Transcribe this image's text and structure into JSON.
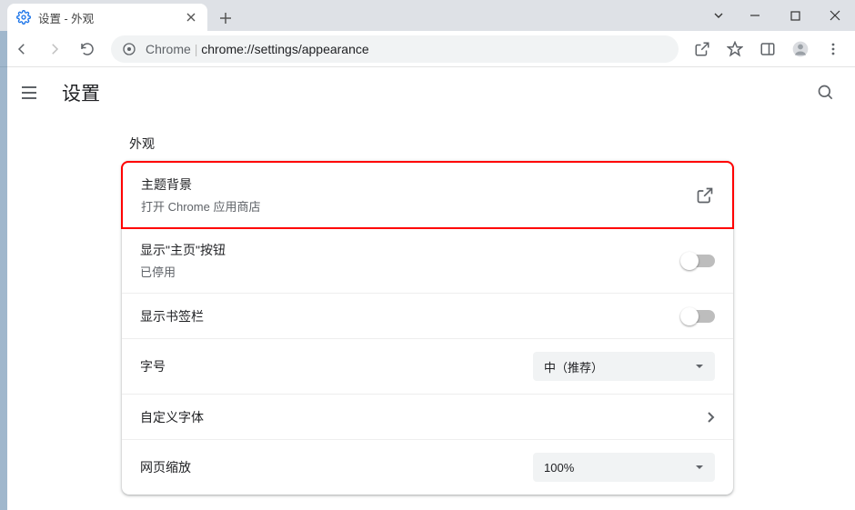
{
  "tab": {
    "title": "设置 - 外观"
  },
  "omnibox": {
    "prefix": "Chrome",
    "path": "chrome://settings/appearance"
  },
  "header": {
    "title": "设置"
  },
  "section": {
    "title": "外观"
  },
  "rows": {
    "theme": {
      "primary": "主题背景",
      "secondary": "打开 Chrome 应用商店"
    },
    "home": {
      "primary": "显示\"主页\"按钮",
      "secondary": "已停用"
    },
    "bookbar": {
      "primary": "显示书签栏"
    },
    "font": {
      "primary": "字号",
      "value": "中（推荐）"
    },
    "custom": {
      "primary": "自定义字体"
    },
    "zoom": {
      "primary": "网页缩放",
      "value": "100%"
    }
  }
}
